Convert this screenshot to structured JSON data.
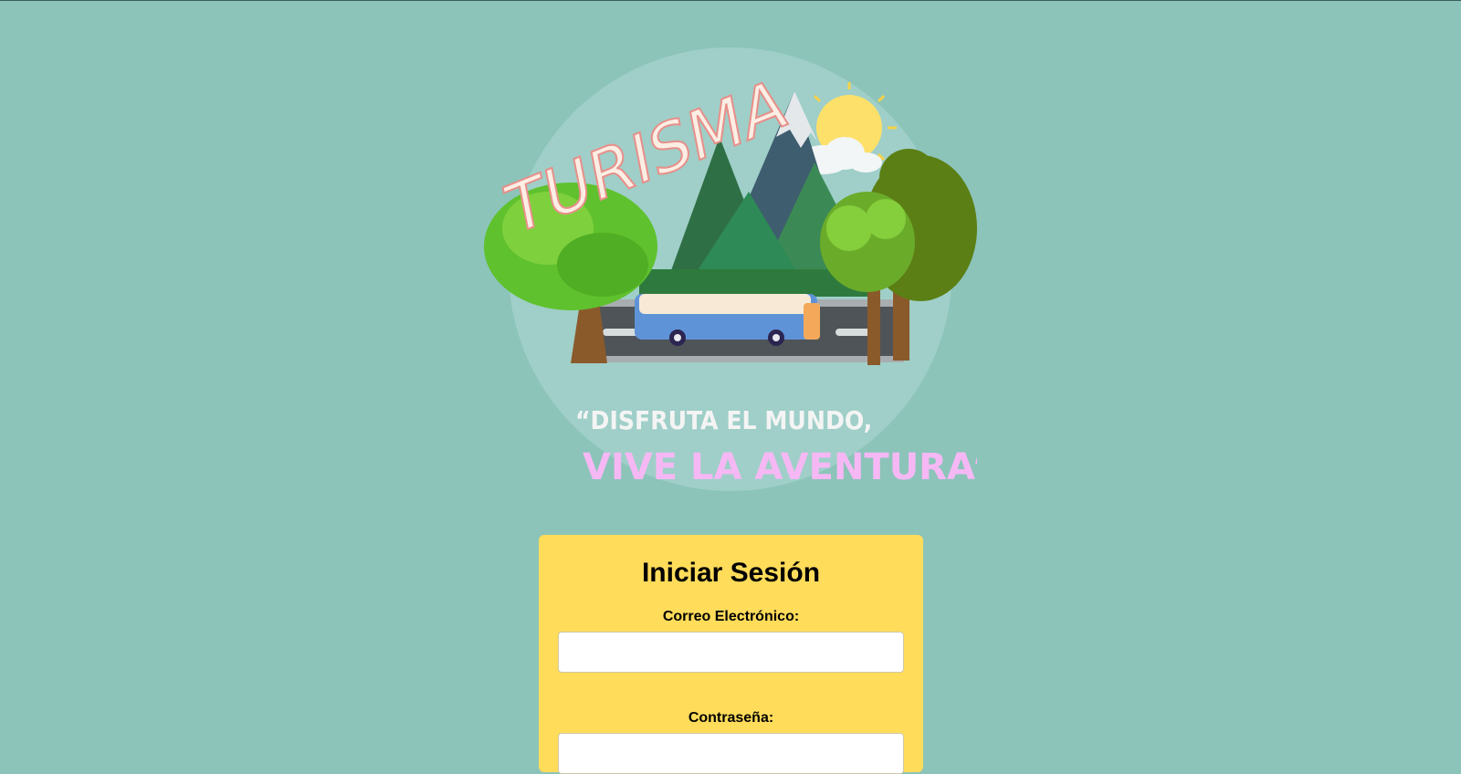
{
  "logo": {
    "title_text": "TURISMA",
    "slogan_line1": "“DISFRUTA EL MUNDO,",
    "slogan_line2": "VIVE LA AVENTURA”"
  },
  "login": {
    "title": "Iniciar Sesión",
    "email_label": "Correo Electrónico:",
    "email_value": "",
    "email_placeholder": "",
    "password_label": "Contraseña:",
    "password_value": "",
    "password_placeholder": ""
  },
  "colors": {
    "background": "#8cc4ba",
    "card": "#ffdc5a",
    "logo_circle": "#9fcfc8",
    "title_text": "#fbeee4",
    "slogan_pink": "#f6b8f4"
  }
}
